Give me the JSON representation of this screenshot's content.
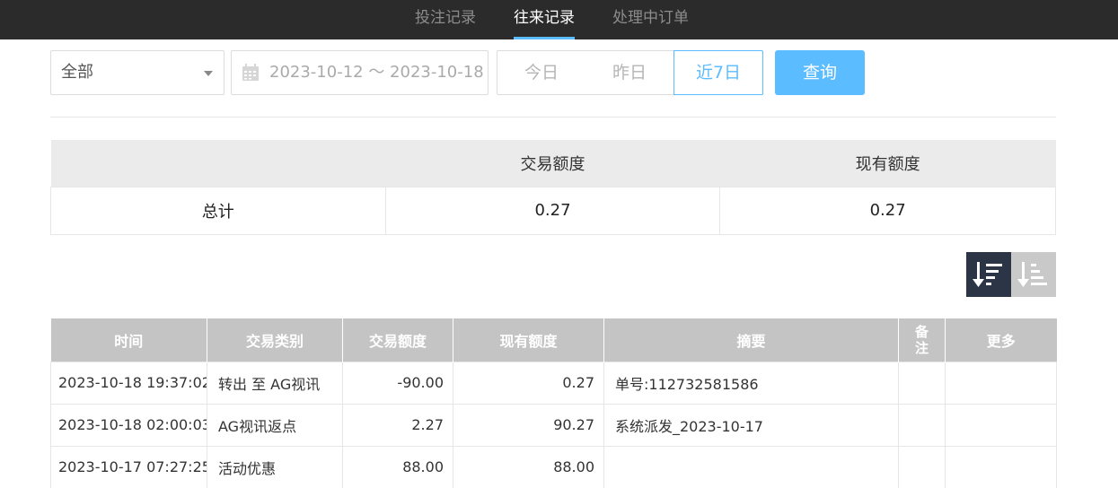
{
  "tabs": [
    {
      "label": "投注记录",
      "active": false
    },
    {
      "label": "往来记录",
      "active": true
    },
    {
      "label": "处理中订单",
      "active": false
    }
  ],
  "filter": {
    "category": "全部",
    "date_range": "2023-10-12 ～ 2023-10-18",
    "quick_ranges": [
      "今日",
      "昨日",
      "近7日"
    ],
    "selected_quick_range": "近7日",
    "search_label": "查询"
  },
  "summary": {
    "headers": [
      "",
      "交易额度",
      "现有额度"
    ],
    "row_label": "总计",
    "transaction_total": "0.27",
    "balance_total": "0.27"
  },
  "sort": {
    "selected": "desc"
  },
  "records": {
    "headers": [
      "时间",
      "交易类别",
      "交易额度",
      "现有额度",
      "摘要",
      "备注",
      "更多"
    ],
    "rows": [
      {
        "time": "2023-10-18 19:37:02",
        "type": "转出 至 AG视讯",
        "amount": "-90.00",
        "balance": "0.27",
        "memo": "单号:112732581586",
        "remark": "",
        "more": ""
      },
      {
        "time": "2023-10-18 02:00:03",
        "type": "AG视讯返点",
        "amount": "2.27",
        "balance": "90.27",
        "memo": "系统派发_2023-10-17",
        "remark": "",
        "more": ""
      },
      {
        "time": "2023-10-17 07:27:25",
        "type": "活动优惠",
        "amount": "88.00",
        "balance": "88.00",
        "memo": "",
        "remark": "",
        "more": ""
      }
    ]
  },
  "colors": {
    "accent": "#5bbcff",
    "topbar": "#2b2b2b",
    "sort_active": "#2c3546",
    "table_header": "#c4c4c4"
  }
}
